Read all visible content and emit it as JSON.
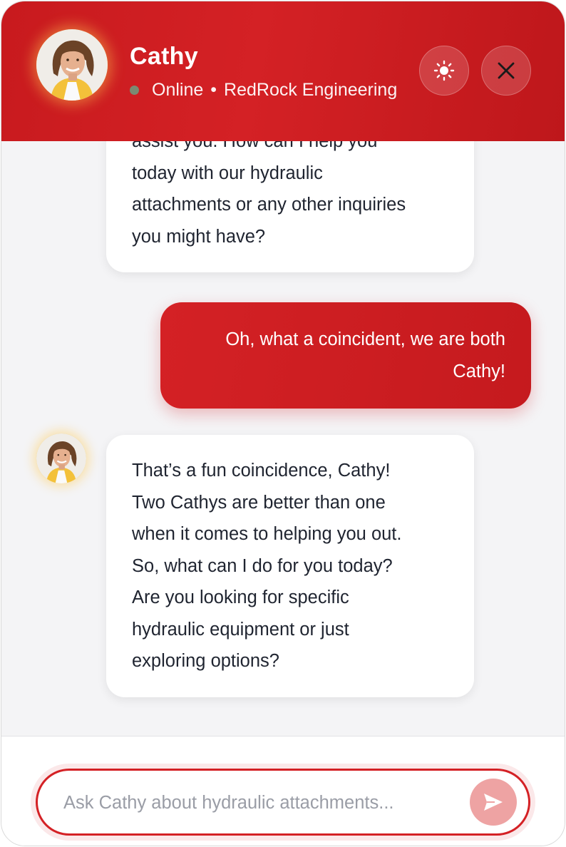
{
  "header": {
    "agent_name": "Cathy",
    "status": "Online",
    "separator": "•",
    "company": "RedRock Engineering",
    "avatar_icon": "agent-avatar",
    "theme_button_icon": "sun-icon",
    "close_button_icon": "close-icon"
  },
  "messages": [
    {
      "role": "assistant",
      "lines": [
        "assist you. How can I help you",
        "today with our hydraulic",
        "attachments or any other inquiries",
        "you might have?"
      ]
    },
    {
      "role": "user",
      "lines": [
        "Oh, what a coincident, we are both",
        "Cathy!"
      ]
    },
    {
      "role": "assistant",
      "lines": [
        "That’s a fun coincidence, Cathy!",
        "Two Cathys are better than one",
        "when it comes to helping you out.",
        "So, what can I do for you today?",
        "Are you looking for specific",
        "hydraulic equipment or just",
        "exploring options?"
      ]
    }
  ],
  "composer": {
    "value": "",
    "placeholder": "Ask Cathy about hydraulic attachments...",
    "send_icon": "send-icon"
  },
  "colors": {
    "brand_red": "#d42125",
    "online_dot": "#7b8a72",
    "send_button_disabled": "#eea3a3"
  }
}
